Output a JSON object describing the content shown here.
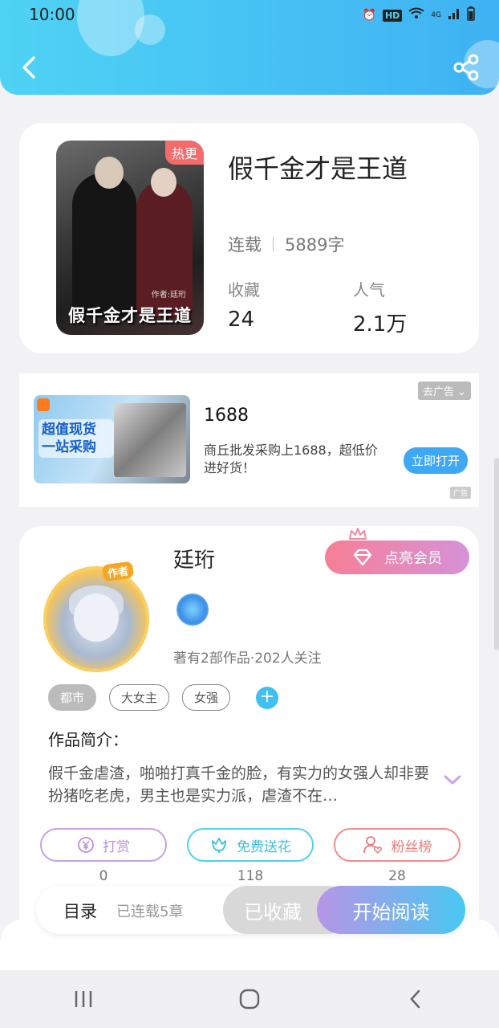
{
  "status_bar": {
    "time": "10:00",
    "hd": "HD",
    "network": "4G"
  },
  "book": {
    "cover_title": "假千金才是王道",
    "cover_author": "作者:廷珩",
    "hot_badge": "热更",
    "title": "假千金才是王道",
    "status": "连载",
    "word_count": "5889字",
    "favorites_label": "收藏",
    "favorites_value": "24",
    "popularity_label": "人气",
    "popularity_value": "2.1万"
  },
  "ad": {
    "slogan": "超值现货 一站采购",
    "title": "1688",
    "description": "商丘批发采购上1688，超低价进好货！",
    "remove_label": "去广告",
    "open_label": "立即打开",
    "tag": "广告"
  },
  "author": {
    "avatar_tag": "作者",
    "name": "廷珩",
    "vip_label": "点亮会员",
    "stats": "著有2部作品·202人关注"
  },
  "tags": [
    "都市",
    "大女主",
    "女强"
  ],
  "intro": {
    "label": "作品简介：",
    "text": "假千金虐渣，啪啪打真千金的脸，有实力的女强人却非要扮猪吃老虎，男主也是实力派，虐渣不在…"
  },
  "actions": [
    {
      "label": "打赏",
      "count": "0"
    },
    {
      "label": "免费送花",
      "count": "118"
    },
    {
      "label": "粉丝榜",
      "count": "28"
    }
  ],
  "bottom_bar": {
    "toc_label": "目录",
    "toc_sub": "已连载5章",
    "collected_label": "已收藏",
    "read_label": "开始阅读"
  },
  "colors": {
    "header_start": "#4fd3f4",
    "header_end": "#3fb2f3",
    "hot_badge": "#f36b6b",
    "read_gradient_start": "#b795e6",
    "read_gradient_end": "#48c8f2"
  }
}
